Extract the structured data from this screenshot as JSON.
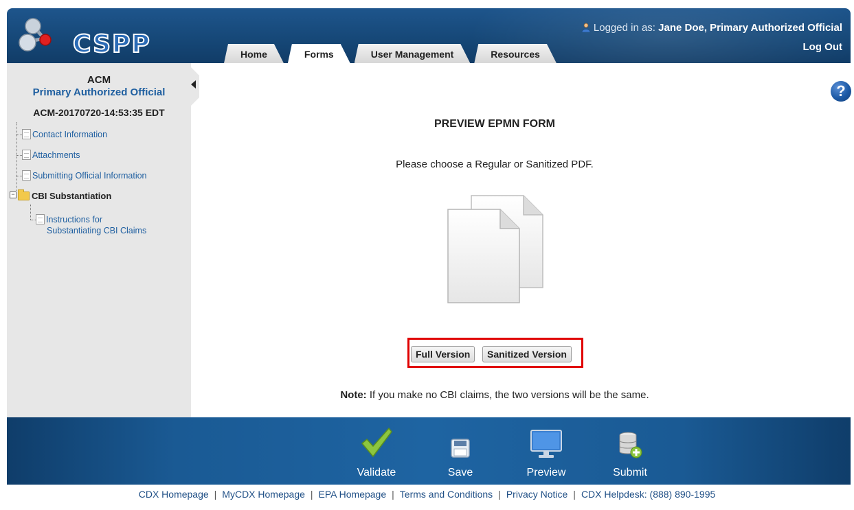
{
  "app": {
    "logo_text": "CSPP"
  },
  "header": {
    "logged_in_label": "Logged in as:",
    "user_name": "Jane Doe, Primary Authorized Official",
    "logout": "Log Out",
    "tabs": [
      {
        "label": "Home",
        "active": false
      },
      {
        "label": "Forms",
        "active": true
      },
      {
        "label": "User Management",
        "active": false
      },
      {
        "label": "Resources",
        "active": false
      }
    ]
  },
  "sidebar": {
    "title": "ACM",
    "subtitle": "Primary Authorized Official",
    "form_id": "ACM-20170720-14:53:35 EDT",
    "items": [
      {
        "label": "Contact Information"
      },
      {
        "label": "Attachments"
      },
      {
        "label": "Submitting Official Information"
      }
    ],
    "folder": {
      "label": "CBI Substantiation",
      "expanded": true,
      "children": [
        {
          "label_line1": "Instructions for",
          "label_line2": "Substantiating CBI Claims"
        }
      ]
    }
  },
  "main": {
    "title": "PREVIEW EPMN FORM",
    "instruction": "Please choose a Regular or Sanitized PDF.",
    "buttons": {
      "full": "Full Version",
      "sanitized": "Sanitized Version"
    },
    "note_label": "Note:",
    "note_text": " If you make no CBI claims, the two versions will be the same.",
    "help_glyph": "?"
  },
  "footer": {
    "actions": [
      {
        "label": "Validate",
        "icon": "checkmark-icon"
      },
      {
        "label": "Save",
        "icon": "floppy-disk-icon"
      },
      {
        "label": "Preview",
        "icon": "monitor-icon"
      },
      {
        "label": "Submit",
        "icon": "database-plus-icon"
      }
    ],
    "links": [
      "CDX Homepage",
      "MyCDX Homepage",
      "EPA Homepage",
      "Terms and Conditions",
      "Privacy Notice"
    ],
    "helpdesk": "CDX Helpdesk: (888) 890-1995"
  },
  "colors": {
    "header_blue": "#164878",
    "link_blue": "#1f5fa0",
    "highlight_red": "#e00000"
  }
}
